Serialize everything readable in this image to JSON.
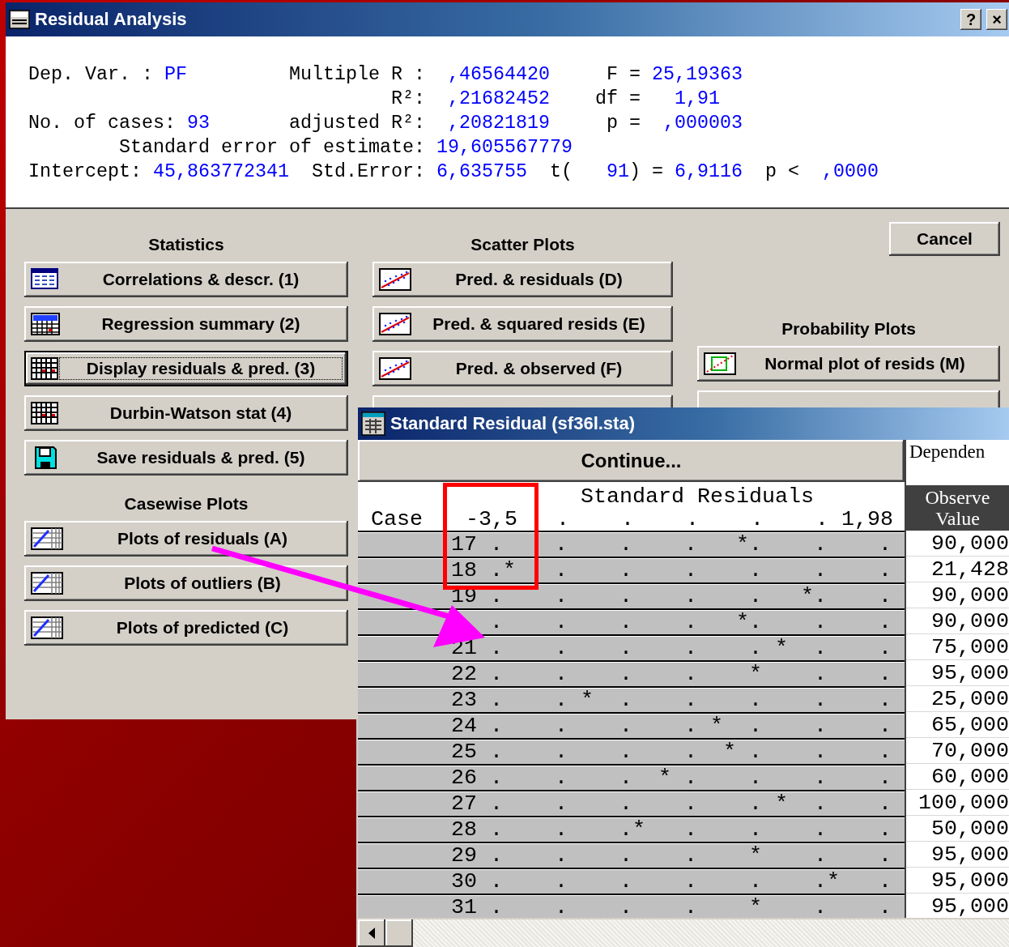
{
  "dialog": {
    "title": "Residual Analysis",
    "help_button": "?",
    "close_button": "×"
  },
  "summary_lines": [
    [
      {
        "text": "Dep. Var. :",
        "kind": "label"
      },
      {
        "text": "PF",
        "kind": "value"
      },
      {
        "text": "Multiple R :",
        "kind": "label"
      },
      {
        "text": ",46564420",
        "kind": "value"
      },
      {
        "text": "F =",
        "kind": "label"
      },
      {
        "text": "25,19363",
        "kind": "value"
      }
    ],
    [
      {
        "text": "R²:",
        "kind": "label"
      },
      {
        "text": ",21682452",
        "kind": "value"
      },
      {
        "text": "df =",
        "kind": "label"
      },
      {
        "text": "1,91",
        "kind": "value"
      }
    ],
    [
      {
        "text": "No. of cases:",
        "kind": "label"
      },
      {
        "text": "93",
        "kind": "value"
      },
      {
        "text": "adjusted R²:",
        "kind": "label"
      },
      {
        "text": ",20821819",
        "kind": "value"
      },
      {
        "text": "p =",
        "kind": "label"
      },
      {
        "text": ",000003",
        "kind": "value"
      }
    ],
    [
      {
        "text": "Standard error of estimate:",
        "kind": "label"
      },
      {
        "text": "19,605567779",
        "kind": "value"
      }
    ],
    [
      {
        "text": "Intercept:",
        "kind": "label"
      },
      {
        "text": "45,863772341",
        "kind": "value"
      },
      {
        "text": "Std.Error:",
        "kind": "label"
      },
      {
        "text": "6,635755",
        "kind": "value"
      },
      {
        "text": "t(",
        "kind": "label"
      },
      {
        "text": "91",
        "kind": "value"
      },
      {
        "text": ") =",
        "kind": "label"
      },
      {
        "text": "6,9116",
        "kind": "value"
      },
      {
        "text": "p <",
        "kind": "label"
      },
      {
        "text": ",0000",
        "kind": "value"
      }
    ]
  ],
  "groups": [
    {
      "heading": "Statistics",
      "buttons": [
        {
          "label": "Correlations & descr. (1)",
          "kind": "table",
          "focused": false
        },
        {
          "label": "Regression summary (2)",
          "kind": "summary",
          "focused": false
        },
        {
          "label": "Display residuals & pred. (3)",
          "kind": "grid",
          "focused": true
        },
        {
          "label": "Durbin-Watson stat (4)",
          "kind": "grid",
          "focused": false
        },
        {
          "label": "Save residuals & pred. (5)",
          "kind": "disk",
          "focused": false
        }
      ]
    },
    {
      "heading": "Casewise Plots",
      "buttons": [
        {
          "label": "Plots of residuals (A)",
          "kind": "casewise",
          "focused": false
        },
        {
          "label": "Plots of outliers (B)",
          "kind": "casewise",
          "focused": false
        },
        {
          "label": "Plots of predicted (C)",
          "kind": "casewise",
          "focused": false
        }
      ]
    },
    {
      "heading": "Scatter Plots",
      "buttons": [
        {
          "label": "Pred. & residuals (D)",
          "kind": "scatter",
          "focused": false
        },
        {
          "label": "Pred. & squared resids (E)",
          "kind": "scatter",
          "focused": false
        },
        {
          "label": "Pred. & observed (F)",
          "kind": "scatter",
          "focused": false
        },
        {
          "focused": false
        }
      ]
    },
    {
      "heading": "Probability Plots",
      "buttons": [
        {
          "label": "Normal plot of resids (M)",
          "kind": "normal",
          "focused": false
        },
        {
          "focused": false
        }
      ]
    }
  ],
  "cancel_button": "Cancel",
  "result_window": {
    "title": "Standard Residual (sf36l.sta)",
    "continue_button": "Continue...",
    "plot_heading": "Standard Residuals",
    "case_heading": "Case",
    "scale": "-3,5   .    .    .    .    . 1,98",
    "side_heading": "Dependen",
    "value_heading": "Observe\nValue",
    "rows": [
      {
        "case": "17",
        "plot": ".    .    .    .   *.    .    .",
        "value": "90,000"
      },
      {
        "case": "18",
        "plot": ".*   .    .    .    .    .    .",
        "value": "21,428"
      },
      {
        "case": "19",
        "plot": ".    .    .    .    .   *.    .",
        "value": "90,000"
      },
      {
        "plot": ".    .    .    .   *.    .    .",
        "value": "90,000"
      },
      {
        "case": "21",
        "plot": ".    .    .    .    . *  .    .",
        "value": "75,000"
      },
      {
        "case": "22",
        "plot": ".    .    .    .    *    .    .",
        "value": "95,000"
      },
      {
        "case": "23",
        "plot": ".    . *  .    .    .    .    .",
        "value": "25,000"
      },
      {
        "case": "24",
        "plot": ".    .    .    . *  .    .    .",
        "value": "65,000"
      },
      {
        "case": "25",
        "plot": ".    .    .    .  * .    .    .",
        "value": "70,000"
      },
      {
        "case": "26",
        "plot": ".    .    .  * .    .    .    .",
        "value": "60,000"
      },
      {
        "case": "27",
        "plot": ".    .    .    .    . *  .    .",
        "value": "100,000"
      },
      {
        "case": "28",
        "plot": ".    .    .*   .    .    .    .",
        "value": "50,000"
      },
      {
        "case": "29",
        "plot": ".    .    .    .    *    .    .",
        "value": "95,000"
      },
      {
        "case": "30",
        "plot": ".    .    .    .    .    .*   .",
        "value": "95,000"
      },
      {
        "case": "31",
        "plot": ".    .    .    .    *    .    .",
        "value": "95,000"
      }
    ]
  }
}
